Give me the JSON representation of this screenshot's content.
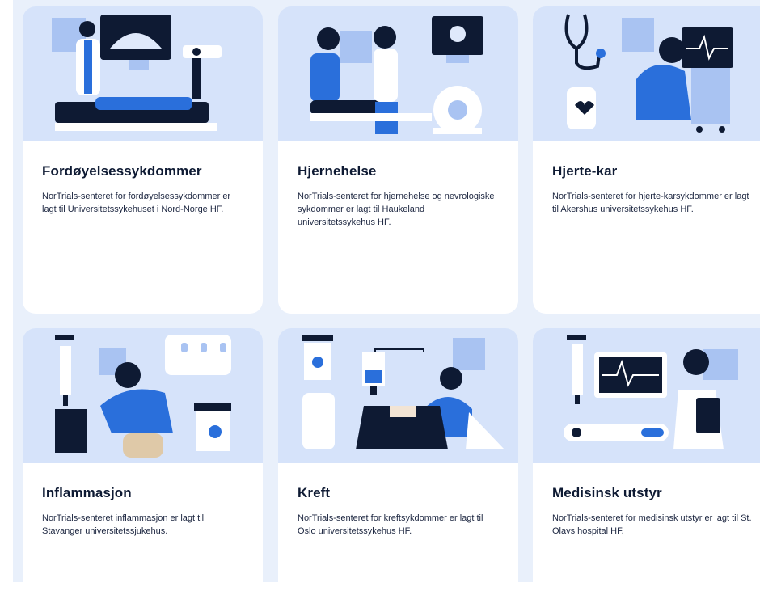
{
  "cards": [
    {
      "title": "Fordøyelsessykdommer",
      "text": "NorTrials-senteret for fordøyelsessykdommer er lagt til Universitetssykehuset i Nord-Norge HF."
    },
    {
      "title": "Hjernehelse",
      "text": "NorTrials-senteret for hjernehelse og nevrologiske sykdommer er lagt til Haukeland universitetssykehus HF."
    },
    {
      "title": "Hjerte-kar",
      "text": "NorTrials-senteret for hjerte-karsykdommer er lagt til Akershus universitetssykehus HF."
    },
    {
      "title": "Inflammasjon",
      "text": "NorTrials-senteret inflammasjon er lagt til Stavanger universitetssjukehus."
    },
    {
      "title": "Kreft",
      "text": "NorTrials-senteret for kreftsykdommer er lagt til Oslo universitetssykehus HF."
    },
    {
      "title": "Medisinsk utstyr",
      "text": "NorTrials-senteret for medisinsk utstyr er lagt til St. Olavs hospital HF."
    }
  ],
  "colors": {
    "illustration_bg": "#d6e3fa",
    "accent_blue": "#2a6fdb",
    "navy": "#0e1a33",
    "page_bg": "#e9f0fb"
  }
}
